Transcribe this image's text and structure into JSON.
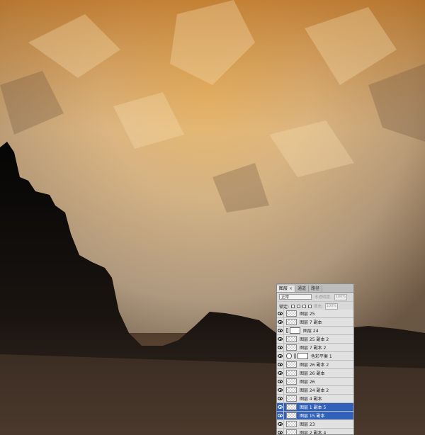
{
  "layers_panel": {
    "tabs": [
      {
        "label": "图层",
        "close": "×",
        "active": true
      },
      {
        "label": "通道",
        "active": false
      },
      {
        "label": "路径",
        "active": false
      }
    ],
    "blend_mode": "正常",
    "opacity_label": "不透明度:",
    "opacity_value": "100%",
    "lock_label": "锁定:",
    "fill_label": "填充:",
    "fill_value": "100%",
    "layers": [
      {
        "name": "图层 25",
        "kind": "pixel",
        "selected": false
      },
      {
        "name": "图层 7 副本",
        "kind": "pixel",
        "selected": false
      },
      {
        "name": "图层 24",
        "kind": "masked",
        "selected": false
      },
      {
        "name": "图层 25 副本 2",
        "kind": "pixel",
        "selected": false
      },
      {
        "name": "图层 7 副本 2",
        "kind": "pixel",
        "selected": false
      },
      {
        "name": "色彩平衡 1",
        "kind": "adjustment",
        "selected": false
      },
      {
        "name": "图层 26 副本 2",
        "kind": "pixel",
        "selected": false
      },
      {
        "name": "图层 26 副本",
        "kind": "pixel",
        "selected": false
      },
      {
        "name": "图层 26",
        "kind": "pixel",
        "selected": false
      },
      {
        "name": "图层 24 副本 2",
        "kind": "pixel",
        "selected": false
      },
      {
        "name": "图层 4 副本",
        "kind": "pixel",
        "selected": false
      },
      {
        "name": "图层 1 副本 5",
        "kind": "pixel",
        "selected": true
      },
      {
        "name": "图层 15 副本",
        "kind": "pixel",
        "selected": true
      },
      {
        "name": "图层 23",
        "kind": "pixel",
        "selected": false
      },
      {
        "name": "图层 2 副本 4",
        "kind": "pixel",
        "selected": false
      }
    ]
  },
  "colors": {
    "selection": "#3161b8",
    "sky_top": "#d18a2a",
    "sky_mid": "#d9c7a8",
    "mountain": "#0d0b0a"
  }
}
